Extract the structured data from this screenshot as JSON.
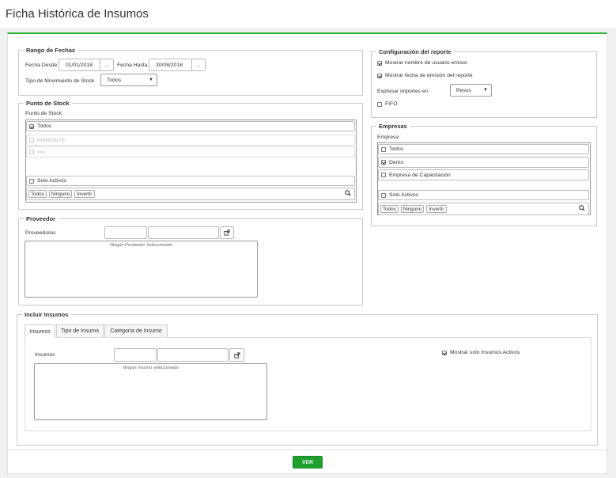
{
  "page_title": "Ficha Histórica de Insumos",
  "accent_color": "#2eb135",
  "rango": {
    "legend": "Rango de Fechas",
    "desde_label": "Fecha Desde",
    "desde_value": "01/01/2018",
    "desde_btn": "...",
    "hasta_label": "Fecha Hasta",
    "hasta_value": "30/08/2018",
    "hasta_btn": "...",
    "tipo_label": "Tipo de Movimiento de Stock",
    "tipo_value": "Todos"
  },
  "punto": {
    "legend": "Punto de Stock",
    "sublabel": "Punto de Stock",
    "items": [
      {
        "label": "Todos",
        "checked": true
      },
      {
        "label": "PIAMONTE",
        "checked": false
      },
      {
        "label": "xxx",
        "checked": false
      }
    ],
    "solo_activos": "Solo Activos",
    "btn_todos": "Todos",
    "btn_ninguno": "Ninguno",
    "btn_invertir": "Invertir",
    "search_icon": "search-icon"
  },
  "proveedor": {
    "legend": "Proveedor",
    "label": "Proveedores",
    "empty_text": "Ningún Proveedor Seleccionado"
  },
  "config": {
    "legend": "Configuración del reporte",
    "opt1": "Mostrar nombre de usuario emisor",
    "opt2": "Mostrar fecha de emisión del reporte",
    "importes_label": "Expresar importes en",
    "importes_value": "Pesos",
    "fifo": "FIFO"
  },
  "empresas": {
    "legend": "Empresas",
    "sublabel": "Empresa",
    "items": [
      {
        "label": "Todos",
        "checked": false
      },
      {
        "label": "Demo",
        "checked": true
      },
      {
        "label": "Empresa de Capacitación",
        "checked": false
      }
    ],
    "solo_activos": "Solo Activos",
    "btn_todos": "Todos",
    "btn_ninguno": "Ninguno",
    "btn_invertir": "Invertir"
  },
  "insumos": {
    "legend": "Incluir Insumos",
    "tabs": [
      "Insumos",
      "Tipo de Insumo",
      "Categoría de Insumo"
    ],
    "label": "Insumos",
    "empty_text": "Ningún Insumo seleccionado",
    "solo_activos": "Mostrar solo Insumos Activos"
  },
  "ver_button": "VER"
}
